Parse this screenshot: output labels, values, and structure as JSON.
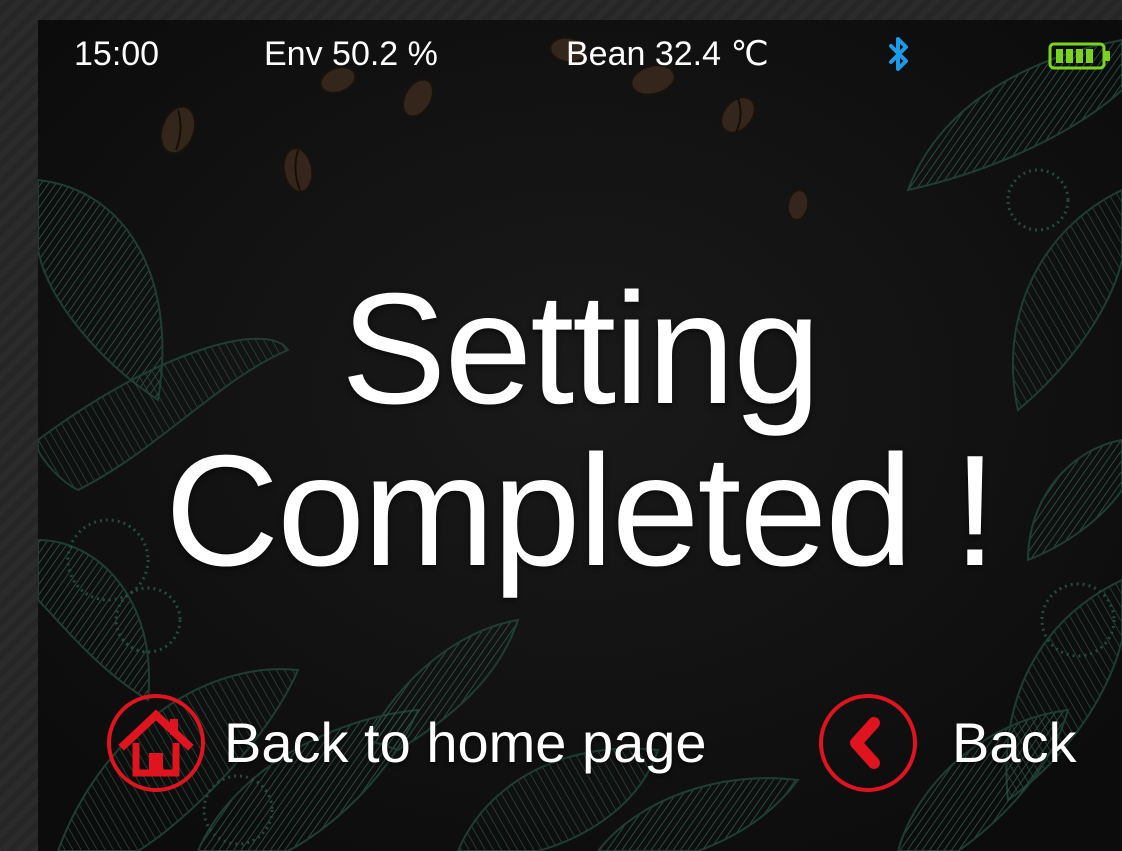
{
  "status": {
    "time": "15:00",
    "env_label": "Env 50.2  %",
    "bean_label": "Bean 32.4  ℃",
    "bluetooth_icon": "bluetooth-icon",
    "battery_icon": "battery-icon",
    "bluetooth_color": "#1e9be8",
    "battery_color": "#7bd321"
  },
  "main": {
    "line1": "Setting",
    "line2": "Completed !"
  },
  "footer": {
    "home_label": "Back to home page",
    "home_icon": "home-icon",
    "back_label": "Back",
    "back_icon": "chevron-left-icon",
    "accent_color": "#e0141e"
  }
}
